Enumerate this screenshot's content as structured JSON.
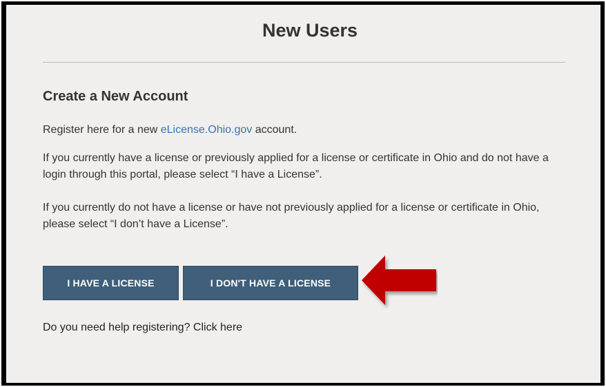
{
  "header": {
    "title": "New Users"
  },
  "section": {
    "title": "Create a New Account",
    "register_prefix": "Register here for a new ",
    "register_link": "eLicense.Ohio.gov",
    "register_suffix": " account.",
    "paragraph_have": "If you currently have a license or previously applied for a license or certificate in Ohio and do not have a login through this portal, please select “I have a License”.",
    "paragraph_not_have": "If you currently do not have a license or have not previously applied for a license or certificate in Ohio, please select “I don’t have a License”."
  },
  "buttons": {
    "have_license": "I HAVE A LICENSE",
    "no_license": "I DON'T HAVE A LICENSE"
  },
  "help": {
    "text": "Do you need help registering? Click here"
  },
  "annotation": {
    "arrow_icon": "left-arrow-icon",
    "arrow_color": "#c00000"
  },
  "colors": {
    "button_bg": "#3f5f7a",
    "link": "#3a72b0",
    "panel_bg": "#f0efed"
  }
}
